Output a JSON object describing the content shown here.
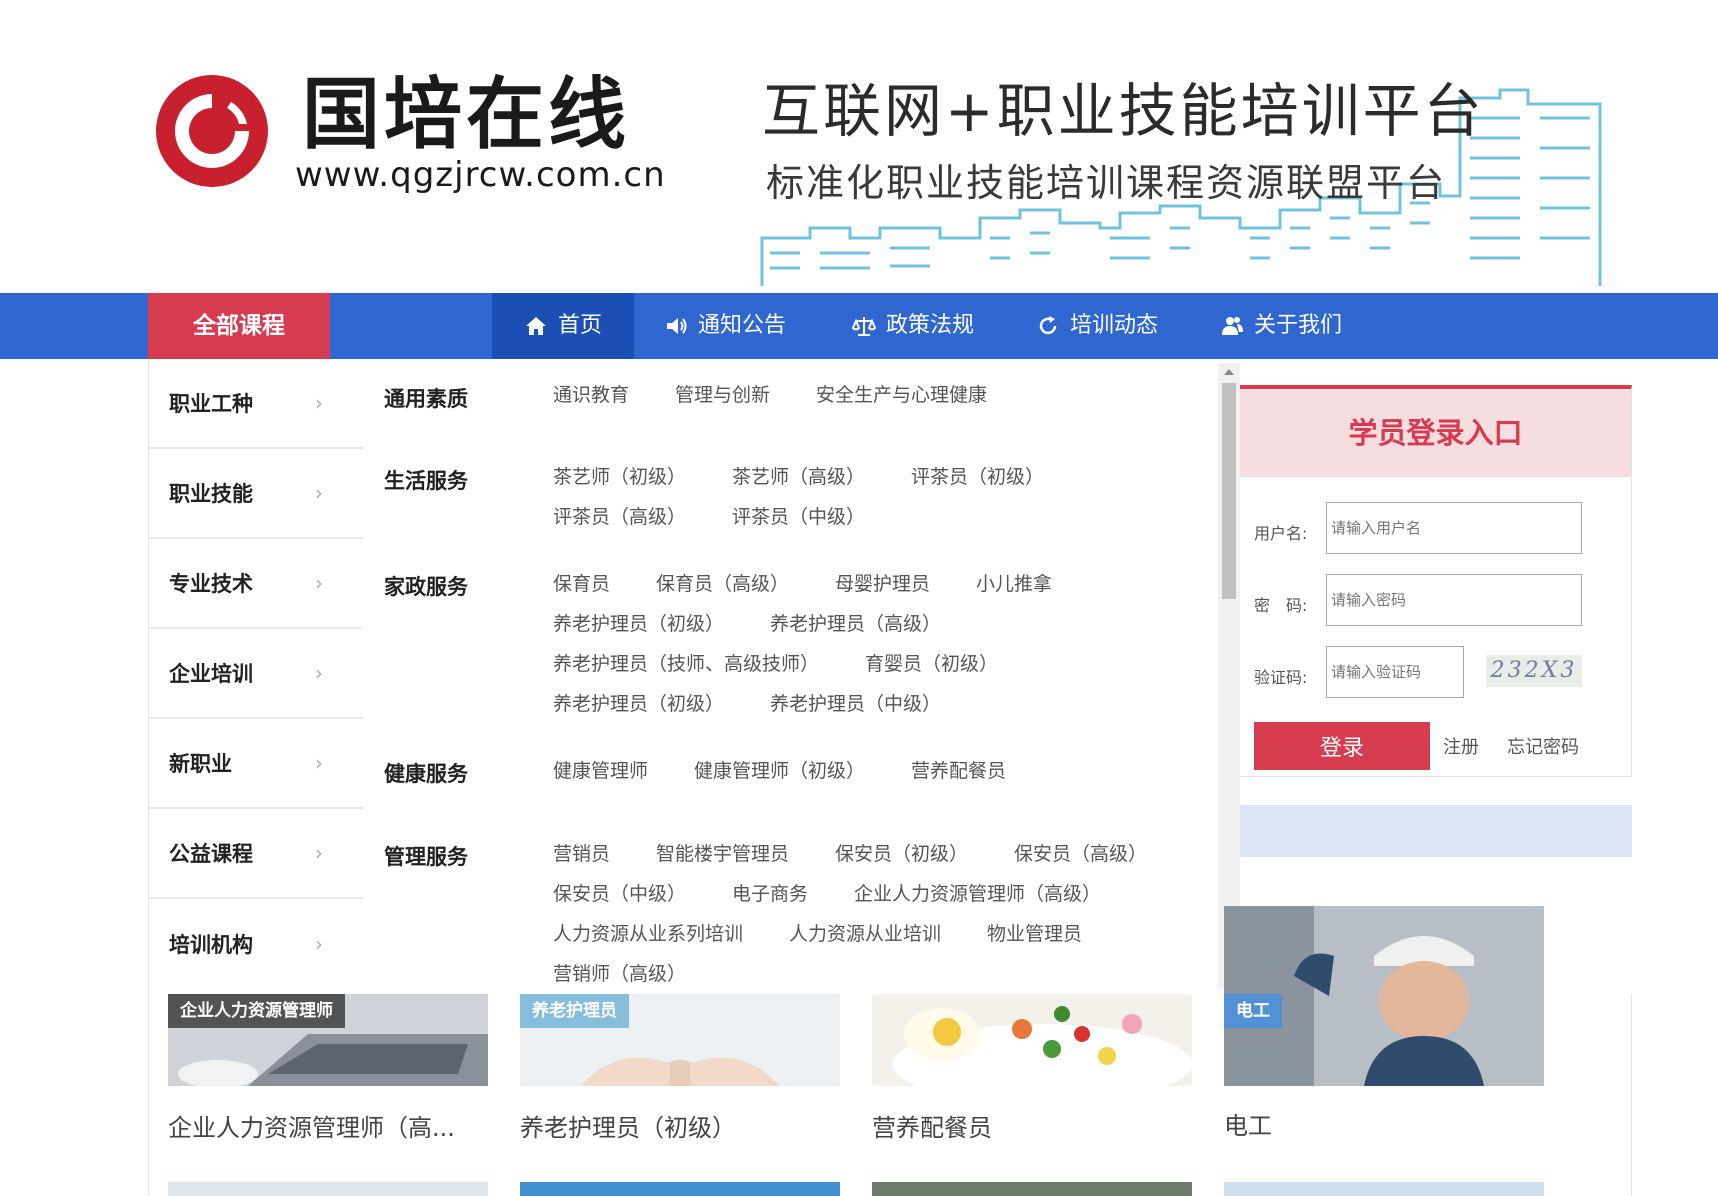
{
  "header": {
    "brand_name": "国培在线",
    "brand_url": "www.qgzjrcw.com.cn",
    "slogan_main": "互联网+职业技能培训平台",
    "slogan_sub": "标准化职业技能培训课程资源联盟平台"
  },
  "nav": {
    "all_courses": "全部课程",
    "items": [
      {
        "label": "首页",
        "icon": "home-icon"
      },
      {
        "label": "通知公告",
        "icon": "speaker-icon"
      },
      {
        "label": "政策法规",
        "icon": "scale-icon"
      },
      {
        "label": "培训动态",
        "icon": "refresh-icon"
      },
      {
        "label": "关于我们",
        "icon": "users-icon"
      }
    ]
  },
  "categories": [
    "职业工种",
    "职业技能",
    "专业技术",
    "企业培训",
    "新职业",
    "公益课程",
    "培训机构"
  ],
  "panel": [
    {
      "title": "通用素质",
      "lines": [
        [
          "通识教育",
          "管理与创新",
          "安全生产与心理健康"
        ]
      ]
    },
    {
      "title": "生活服务",
      "lines": [
        [
          "茶艺师（初级）",
          "茶艺师（高级）",
          "评茶员（初级）"
        ],
        [
          "评茶员（高级）",
          "评茶员（中级）"
        ]
      ]
    },
    {
      "title": "家政服务",
      "lines": [
        [
          "保育员",
          "保育员（高级）",
          "母婴护理员",
          "小儿推拿"
        ],
        [
          "养老护理员（初级）",
          "养老护理员（高级）"
        ],
        [
          "养老护理员（技师、高级技师）",
          "育婴员（初级）"
        ],
        [
          "养老护理员（初级）",
          "养老护理员（中级）"
        ]
      ]
    },
    {
      "title": "健康服务",
      "lines": [
        [
          "健康管理师",
          "健康管理师（初级）",
          "营养配餐员"
        ]
      ]
    },
    {
      "title": "管理服务",
      "lines": [
        [
          "营销员",
          "智能楼宇管理员",
          "保安员（初级）",
          "保安员（高级）"
        ],
        [
          "保安员（中级）",
          "电子商务",
          "企业人力资源管理师（高级）"
        ],
        [
          "人力资源从业系列培训",
          "人力资源从业培训",
          "物业管理员"
        ],
        [
          "营销师（高级）"
        ]
      ]
    }
  ],
  "login": {
    "title": "学员登录入口",
    "username_label": "用户名:",
    "username_placeholder": "请输入用户名",
    "password_label": "密　码:",
    "password_placeholder": "请输入密码",
    "captcha_label": "验证码:",
    "captcha_placeholder": "请输入验证码",
    "captcha_text": "232X3",
    "login_button": "登录",
    "register": "注册",
    "forgot": "忘记密码"
  },
  "courses": [
    {
      "tag": "企业人力资源管理师",
      "title": "企业人力资源管理师（高...",
      "tag_color": "#4a4a4a"
    },
    {
      "tag": "养老护理员",
      "title": "养老护理员（初级）",
      "tag_color": "#7ab8d8"
    },
    {
      "tag": "",
      "title": "营养配餐员",
      "tag_color": "#000000"
    },
    {
      "tag": "电工",
      "title": "电工",
      "tag_color": "#4a90d9"
    }
  ],
  "colors": {
    "primary_blue": "#2f66d0",
    "accent_red": "#d63b4f"
  }
}
